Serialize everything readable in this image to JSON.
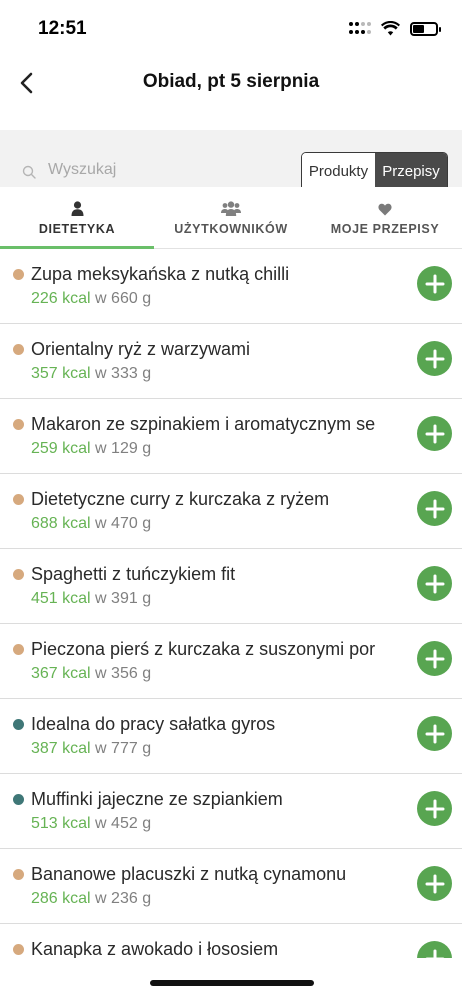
{
  "status_bar": {
    "time": "12:51"
  },
  "header": {
    "title": "Obiad, pt 5 sierpnia"
  },
  "search": {
    "placeholder": "Wyszukaj",
    "value": ""
  },
  "segment": {
    "products_label": "Produkty",
    "recipes_label": "Przepisy",
    "selected": "Przepisy"
  },
  "tabs": [
    {
      "label": "DIETETYKA",
      "icon": "person-icon",
      "active": true
    },
    {
      "label": "UŻYTKOWNIKÓW",
      "icon": "users-icon",
      "active": false
    },
    {
      "label": "MOJE PRZEPISY",
      "icon": "heart-icon",
      "active": false
    }
  ],
  "colors": {
    "accent_green": "#66b354",
    "add_button_green": "#58a551",
    "dot_tan": "#d6a97e",
    "dot_teal": "#3f7777"
  },
  "recipes": [
    {
      "name": "Zupa meksykańska z nutką chilli",
      "kcal": "226 kcal",
      "weight": "w 660 g",
      "dot": "tan"
    },
    {
      "name": "Orientalny ryż z warzywami",
      "kcal": "357 kcal",
      "weight": "w 333 g",
      "dot": "tan"
    },
    {
      "name": "Makaron ze szpinakiem i aromatycznym se",
      "kcal": "259 kcal",
      "weight": "w 129 g",
      "dot": "tan"
    },
    {
      "name": "Dietetyczne curry z kurczaka z ryżem",
      "kcal": "688 kcal",
      "weight": "w 470 g",
      "dot": "tan"
    },
    {
      "name": "Spaghetti z tuńczykiem fit",
      "kcal": "451 kcal",
      "weight": "w 391 g",
      "dot": "tan"
    },
    {
      "name": "Pieczona pierś z kurczaka z suszonymi por",
      "kcal": "367 kcal",
      "weight": "w 356 g",
      "dot": "tan"
    },
    {
      "name": "Idealna do pracy sałatka gyros",
      "kcal": "387 kcal",
      "weight": "w 777 g",
      "dot": "teal"
    },
    {
      "name": "Muffinki jajeczne ze szpiankiem",
      "kcal": "513 kcal",
      "weight": "w 452 g",
      "dot": "teal"
    },
    {
      "name": "Bananowe placuszki z nutką cynamonu",
      "kcal": "286 kcal",
      "weight": "w 236 g",
      "dot": "tan"
    },
    {
      "name": "Kanapka z awokado i łososiem",
      "kcal": "",
      "weight": "",
      "dot": "tan"
    }
  ]
}
